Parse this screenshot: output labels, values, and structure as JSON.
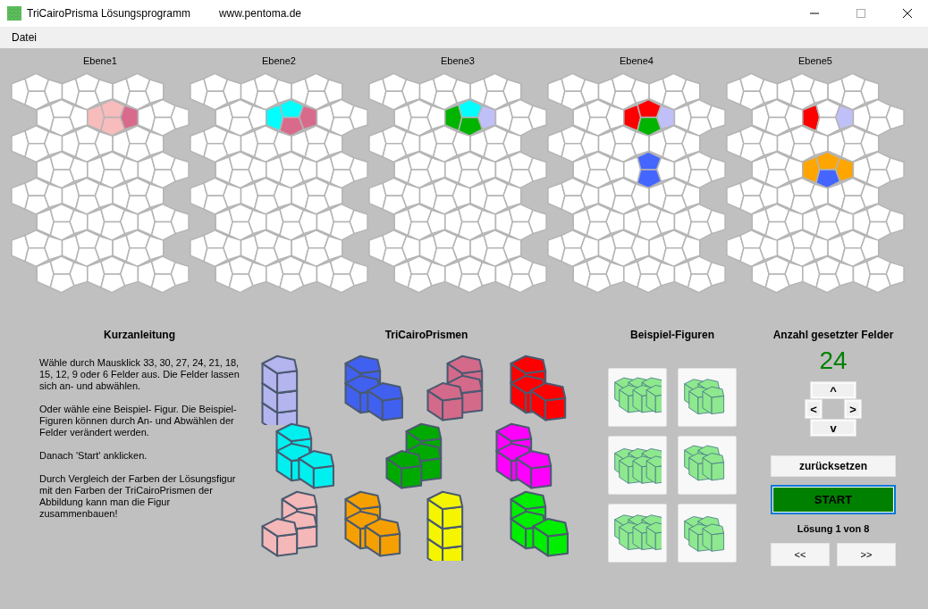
{
  "window": {
    "title": "TriCairoPrisma Lösungsprogramm",
    "url": "www.pentoma.de"
  },
  "menu": [
    "Datei"
  ],
  "levels": [
    {
      "label": "Ebene1",
      "cells": [
        {
          "color": "#f8bcbc"
        },
        {
          "color": "#f8bcbc"
        },
        {
          "color": "#d86b8c"
        },
        {
          "color": "#f8bcbc"
        }
      ]
    },
    {
      "label": "Ebene2",
      "cells": [
        {
          "color": "#00ffff"
        },
        {
          "color": "#00ffff"
        },
        {
          "color": "#d86b8c"
        },
        {
          "color": "#d86b8c"
        }
      ]
    },
    {
      "label": "Ebene3",
      "cells": [
        {
          "color": "#00b400"
        },
        {
          "color": "#00ffff"
        },
        {
          "color": "#c0c0f8"
        },
        {
          "color": "#00b400"
        }
      ]
    },
    {
      "label": "Ebene4",
      "cells": [
        {
          "color": "#ff0000"
        },
        {
          "color": "#ff0000"
        },
        {
          "color": "#c0c0f8"
        },
        {
          "color": "#00b400"
        },
        {
          "color": "#4466ff"
        },
        {
          "color": "#4466ff"
        }
      ]
    },
    {
      "label": "Ebene5",
      "cells": [
        {
          "color": "#ff0000"
        },
        {
          "color": "#c0c0f8"
        },
        {
          "color": "#ffa500"
        },
        {
          "color": "#ffa500"
        },
        {
          "color": "#ffa500"
        },
        {
          "color": "#4466ff"
        }
      ]
    }
  ],
  "instructions": {
    "title": "Kurzanleitung",
    "paragraphs": [
      "Wähle durch Mausklick 33, 30, 27, 24, 21, 18, 15, 12, 9 oder 6 Felder aus. Die Felder lassen sich an- und abwählen.",
      "Oder wähle eine Beispiel- Figur. Die Beispiel-Figuren können durch An- und Abwählen der Felder verändert werden.",
      "Danach 'Start' anklicken.",
      "Durch Vergleich der Farben der Lösungsfigur mit den Farben der TriCairoPrismen der Abbildung kann man die Figur zusammenbauen!"
    ]
  },
  "prisms": {
    "title": "TriCairoPrismen",
    "rows": [
      [
        {
          "color": "#b4b4ee"
        },
        {
          "color": "#4060f0"
        },
        {
          "color": "#d46a8a"
        },
        {
          "color": "#ff0000"
        }
      ],
      [
        {
          "color": "#00f0f0"
        },
        {
          "color": "#00aa00"
        },
        {
          "color": "#ff00ff"
        }
      ],
      [
        {
          "color": "#f4b8b8"
        },
        {
          "color": "#f5a000"
        },
        {
          "color": "#f5f500"
        },
        {
          "color": "#00ee00"
        }
      ]
    ]
  },
  "examples": {
    "title": "Beispiel-Figuren"
  },
  "counter": {
    "label": "Anzahl gesetzter Felder",
    "value": "24"
  },
  "nav_buttons": [
    {
      "label": "^",
      "kind": "up"
    },
    {
      "label": "<",
      "kind": "left"
    },
    {
      "label": ">",
      "kind": "right"
    },
    {
      "label": "v",
      "kind": "down"
    }
  ],
  "reset_button": "zurücksetzen",
  "start_button": "START",
  "solution": "Lösung 1 von 8",
  "paging": [
    "<<",
    ">>"
  ]
}
